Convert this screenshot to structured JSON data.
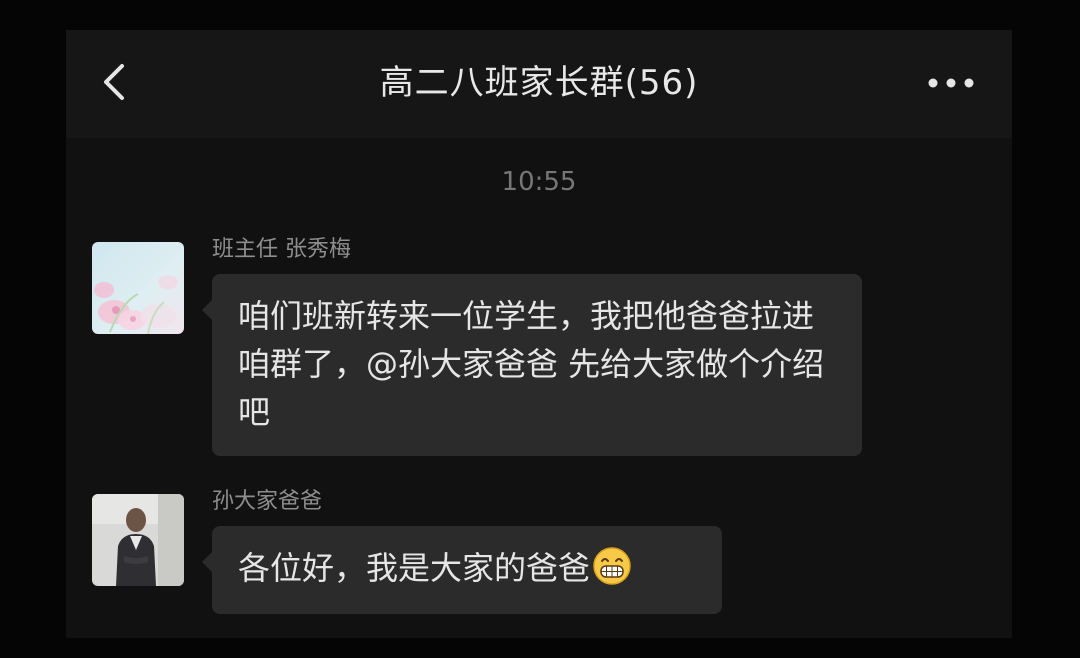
{
  "header": {
    "back_icon": "chevron-left-icon",
    "title": "高二八班家长群(56)",
    "more_icon": "more-dots-icon"
  },
  "chat": {
    "timestamp": "10:55",
    "messages": [
      {
        "sender": "班主任 张秀梅",
        "avatar": "flower-avatar",
        "text": "咱们班新转来一位学生，我把他爸爸拉进咱群了，@孙大家爸爸 先给大家做个介绍吧"
      },
      {
        "sender": "孙大家爸爸",
        "avatar": "man-avatar",
        "text": "各位好，我是大家的爸爸",
        "emoji": "grinning-face-icon"
      }
    ]
  },
  "colors": {
    "background": "#111111",
    "bubble": "#2b2b2b",
    "text": "#e6e6e6",
    "meta_text": "#8e8e8e"
  }
}
